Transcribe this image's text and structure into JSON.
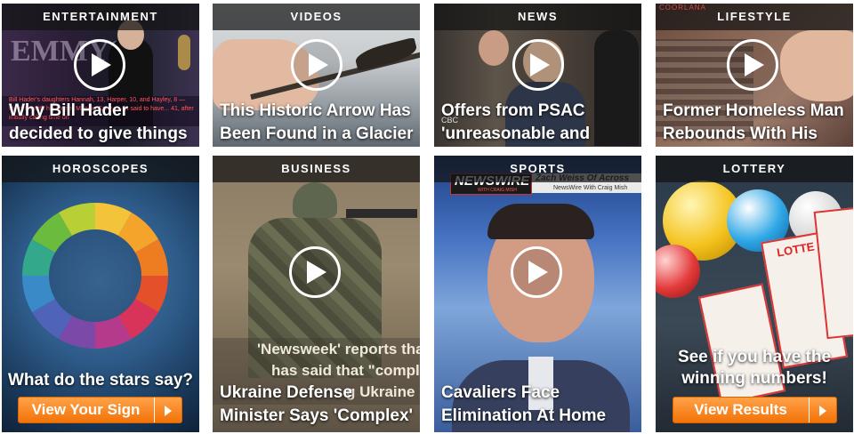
{
  "tiles": [
    {
      "category": "ENTERTAINMENT",
      "headline_1": "Why Bill Hader",
      "headline_2": "decided to give things",
      "caption": "Bill Hader's daughters Hannah, 13, Harper, 10, and Hayley, 8 — together with his former Maggie Carey — is said to have... 41, after initially calling time on"
    },
    {
      "category": "VIDEOS",
      "headline_1": "This Historic Arrow Has",
      "headline_2": "Been Found in a Glacier"
    },
    {
      "category": "NEWS",
      "headline_1": "Offers from PSAC",
      "headline_2": "'unreasonable and",
      "source": "CBC"
    },
    {
      "category": "LIFESTYLE",
      "headline_1": "Former Homeless Man",
      "headline_2": "Rebounds With His",
      "sign": "COORLANA"
    },
    {
      "category": "HOROSCOPES",
      "promo": "What do the stars say?",
      "cta": "View Your Sign"
    },
    {
      "category": "BUSINESS",
      "overlay_1": "'Newsweek' reports tha",
      "overlay_2": "has said that \"comple",
      "overlay_3": "g Ukraine",
      "headline_1": "Ukraine Defense",
      "headline_2": "Minister Says 'Complex'"
    },
    {
      "category": "SPORTS",
      "show": "NEWSWIRE",
      "show_sub": "WITH CRAIG MISH",
      "banner": "Zach Weiss Of Across",
      "banner_sub": "NewsWire With Craig Mish",
      "headline_1": "Cavaliers Face",
      "headline_2": "Elimination At Home"
    },
    {
      "category": "LOTTERY",
      "ticket": "LOTTE",
      "promo_1": "See if you have the",
      "promo_2": "winning numbers!",
      "cta": "View Results"
    }
  ],
  "colors": {
    "accent": "#f27308",
    "header_bg": "#141414"
  }
}
